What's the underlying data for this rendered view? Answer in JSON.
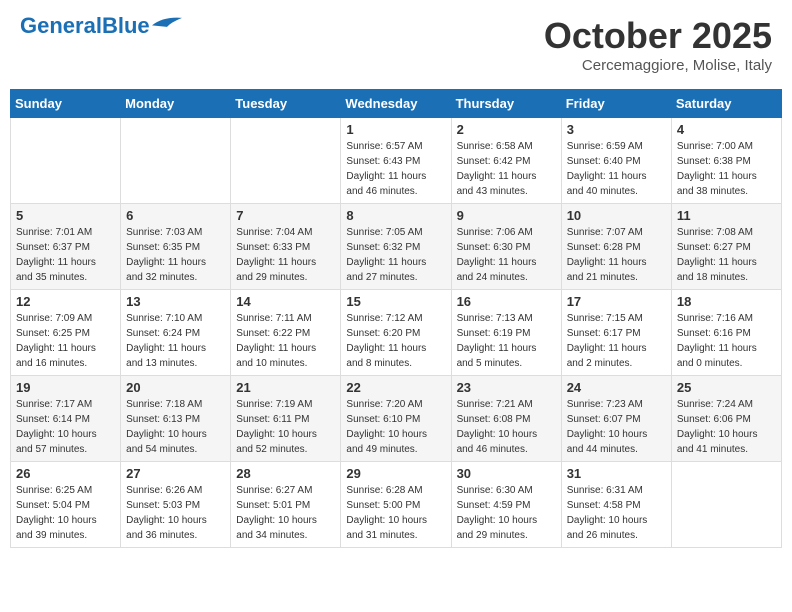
{
  "logo": {
    "part1": "General",
    "part2": "Blue"
  },
  "title": "October 2025",
  "subtitle": "Cercemaggiore, Molise, Italy",
  "weekdays": [
    "Sunday",
    "Monday",
    "Tuesday",
    "Wednesday",
    "Thursday",
    "Friday",
    "Saturday"
  ],
  "weeks": [
    [
      {
        "day": "",
        "info": ""
      },
      {
        "day": "",
        "info": ""
      },
      {
        "day": "",
        "info": ""
      },
      {
        "day": "1",
        "info": "Sunrise: 6:57 AM\nSunset: 6:43 PM\nDaylight: 11 hours and 46 minutes."
      },
      {
        "day": "2",
        "info": "Sunrise: 6:58 AM\nSunset: 6:42 PM\nDaylight: 11 hours and 43 minutes."
      },
      {
        "day": "3",
        "info": "Sunrise: 6:59 AM\nSunset: 6:40 PM\nDaylight: 11 hours and 40 minutes."
      },
      {
        "day": "4",
        "info": "Sunrise: 7:00 AM\nSunset: 6:38 PM\nDaylight: 11 hours and 38 minutes."
      }
    ],
    [
      {
        "day": "5",
        "info": "Sunrise: 7:01 AM\nSunset: 6:37 PM\nDaylight: 11 hours and 35 minutes."
      },
      {
        "day": "6",
        "info": "Sunrise: 7:03 AM\nSunset: 6:35 PM\nDaylight: 11 hours and 32 minutes."
      },
      {
        "day": "7",
        "info": "Sunrise: 7:04 AM\nSunset: 6:33 PM\nDaylight: 11 hours and 29 minutes."
      },
      {
        "day": "8",
        "info": "Sunrise: 7:05 AM\nSunset: 6:32 PM\nDaylight: 11 hours and 27 minutes."
      },
      {
        "day": "9",
        "info": "Sunrise: 7:06 AM\nSunset: 6:30 PM\nDaylight: 11 hours and 24 minutes."
      },
      {
        "day": "10",
        "info": "Sunrise: 7:07 AM\nSunset: 6:28 PM\nDaylight: 11 hours and 21 minutes."
      },
      {
        "day": "11",
        "info": "Sunrise: 7:08 AM\nSunset: 6:27 PM\nDaylight: 11 hours and 18 minutes."
      }
    ],
    [
      {
        "day": "12",
        "info": "Sunrise: 7:09 AM\nSunset: 6:25 PM\nDaylight: 11 hours and 16 minutes."
      },
      {
        "day": "13",
        "info": "Sunrise: 7:10 AM\nSunset: 6:24 PM\nDaylight: 11 hours and 13 minutes."
      },
      {
        "day": "14",
        "info": "Sunrise: 7:11 AM\nSunset: 6:22 PM\nDaylight: 11 hours and 10 minutes."
      },
      {
        "day": "15",
        "info": "Sunrise: 7:12 AM\nSunset: 6:20 PM\nDaylight: 11 hours and 8 minutes."
      },
      {
        "day": "16",
        "info": "Sunrise: 7:13 AM\nSunset: 6:19 PM\nDaylight: 11 hours and 5 minutes."
      },
      {
        "day": "17",
        "info": "Sunrise: 7:15 AM\nSunset: 6:17 PM\nDaylight: 11 hours and 2 minutes."
      },
      {
        "day": "18",
        "info": "Sunrise: 7:16 AM\nSunset: 6:16 PM\nDaylight: 11 hours and 0 minutes."
      }
    ],
    [
      {
        "day": "19",
        "info": "Sunrise: 7:17 AM\nSunset: 6:14 PM\nDaylight: 10 hours and 57 minutes."
      },
      {
        "day": "20",
        "info": "Sunrise: 7:18 AM\nSunset: 6:13 PM\nDaylight: 10 hours and 54 minutes."
      },
      {
        "day": "21",
        "info": "Sunrise: 7:19 AM\nSunset: 6:11 PM\nDaylight: 10 hours and 52 minutes."
      },
      {
        "day": "22",
        "info": "Sunrise: 7:20 AM\nSunset: 6:10 PM\nDaylight: 10 hours and 49 minutes."
      },
      {
        "day": "23",
        "info": "Sunrise: 7:21 AM\nSunset: 6:08 PM\nDaylight: 10 hours and 46 minutes."
      },
      {
        "day": "24",
        "info": "Sunrise: 7:23 AM\nSunset: 6:07 PM\nDaylight: 10 hours and 44 minutes."
      },
      {
        "day": "25",
        "info": "Sunrise: 7:24 AM\nSunset: 6:06 PM\nDaylight: 10 hours and 41 minutes."
      }
    ],
    [
      {
        "day": "26",
        "info": "Sunrise: 6:25 AM\nSunset: 5:04 PM\nDaylight: 10 hours and 39 minutes."
      },
      {
        "day": "27",
        "info": "Sunrise: 6:26 AM\nSunset: 5:03 PM\nDaylight: 10 hours and 36 minutes."
      },
      {
        "day": "28",
        "info": "Sunrise: 6:27 AM\nSunset: 5:01 PM\nDaylight: 10 hours and 34 minutes."
      },
      {
        "day": "29",
        "info": "Sunrise: 6:28 AM\nSunset: 5:00 PM\nDaylight: 10 hours and 31 minutes."
      },
      {
        "day": "30",
        "info": "Sunrise: 6:30 AM\nSunset: 4:59 PM\nDaylight: 10 hours and 29 minutes."
      },
      {
        "day": "31",
        "info": "Sunrise: 6:31 AM\nSunset: 4:58 PM\nDaylight: 10 hours and 26 minutes."
      },
      {
        "day": "",
        "info": ""
      }
    ]
  ]
}
